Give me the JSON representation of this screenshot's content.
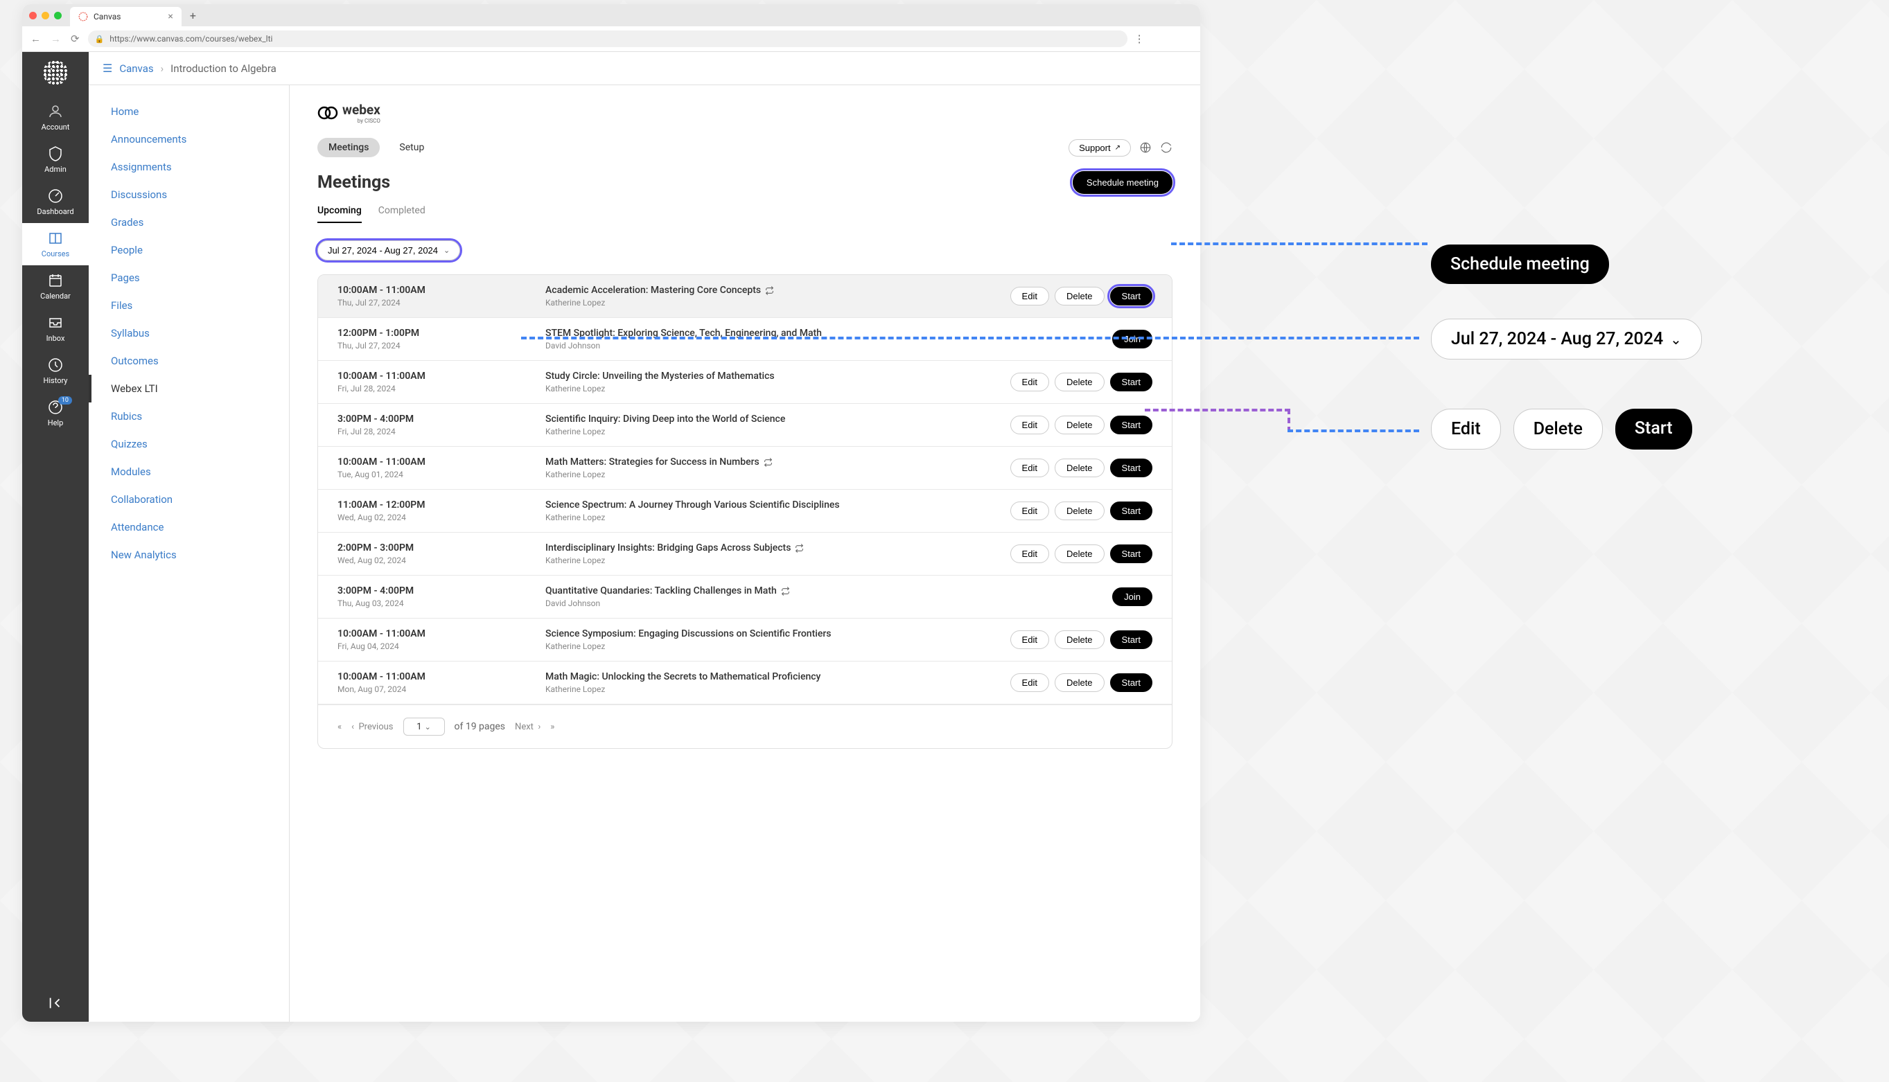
{
  "browser": {
    "tab_title": "Canvas",
    "url": "https://www.canvas.com/courses/webex_lti"
  },
  "global_nav": {
    "items": [
      {
        "label": "Account",
        "icon": "account"
      },
      {
        "label": "Admin",
        "icon": "admin"
      },
      {
        "label": "Dashboard",
        "icon": "dashboard"
      },
      {
        "label": "Courses",
        "icon": "courses",
        "active": true
      },
      {
        "label": "Calendar",
        "icon": "calendar"
      },
      {
        "label": "Inbox",
        "icon": "inbox"
      },
      {
        "label": "History",
        "icon": "history"
      },
      {
        "label": "Help",
        "icon": "help",
        "badge": "10"
      }
    ]
  },
  "breadcrumb": {
    "root": "Canvas",
    "current": "Introduction to Algebra"
  },
  "course_nav": {
    "items": [
      "Home",
      "Announcements",
      "Assignments",
      "Discussions",
      "Grades",
      "People",
      "Pages",
      "Files",
      "Syllabus",
      "Outcomes",
      "Webex LTI",
      "Rubics",
      "Quizzes",
      "Modules",
      "Collaboration",
      "Attendance",
      "New Analytics"
    ],
    "active": "Webex LTI"
  },
  "webex": {
    "logo": "webex",
    "logo_sub": "by CISCO",
    "main_tabs": {
      "meetings": "Meetings",
      "setup": "Setup"
    },
    "support": "Support",
    "title": "Meetings",
    "schedule_btn": "Schedule meeting",
    "subtabs": {
      "upcoming": "Upcoming",
      "completed": "Completed"
    },
    "date_range": "Jul 27, 2024 - Aug 27, 2024",
    "actions": {
      "edit": "Edit",
      "delete": "Delete",
      "start": "Start",
      "join": "Join"
    },
    "meetings": [
      {
        "time_range": "10:00AM - 11:00AM",
        "date": "Thu, Jul 27, 2024",
        "title": "Academic Acceleration: Mastering Core Concepts",
        "host": "Katherine Lopez",
        "recurring": true,
        "buttons": [
          "edit",
          "delete",
          "start"
        ],
        "highlighted": true,
        "start_focused": true
      },
      {
        "time_range": "12:00PM - 1:00PM",
        "date": "Thu, Jul 27, 2024",
        "title": "STEM Spotlight: Exploring Science, Tech, Engineering, and Math",
        "host": "David Johnson",
        "recurring": false,
        "buttons": [
          "join"
        ]
      },
      {
        "time_range": "10:00AM - 11:00AM",
        "date": "Fri, Jul 28, 2024",
        "title": "Study Circle: Unveiling the Mysteries of Mathematics",
        "host": "Katherine Lopez",
        "recurring": false,
        "buttons": [
          "edit",
          "delete",
          "start"
        ]
      },
      {
        "time_range": "3:00PM - 4:00PM",
        "date": "Fri, Jul 28, 2024",
        "title": "Scientific Inquiry: Diving Deep into the World of Science",
        "host": "Katherine Lopez",
        "recurring": false,
        "buttons": [
          "edit",
          "delete",
          "start"
        ]
      },
      {
        "time_range": "10:00AM - 11:00AM",
        "date": "Tue, Aug 01, 2024",
        "title": "Math Matters: Strategies for Success in Numbers",
        "host": "Katherine Lopez",
        "recurring": true,
        "buttons": [
          "edit",
          "delete",
          "start"
        ]
      },
      {
        "time_range": "11:00AM - 12:00PM",
        "date": "Wed, Aug 02, 2024",
        "title": "Science Spectrum: A Journey Through Various Scientific Disciplines",
        "host": "Katherine Lopez",
        "recurring": false,
        "buttons": [
          "edit",
          "delete",
          "start"
        ]
      },
      {
        "time_range": "2:00PM - 3:00PM",
        "date": "Wed, Aug 02, 2024",
        "title": "Interdisciplinary Insights: Bridging Gaps Across Subjects",
        "host": "Katherine Lopez",
        "recurring": true,
        "buttons": [
          "edit",
          "delete",
          "start"
        ]
      },
      {
        "time_range": "3:00PM - 4:00PM",
        "date": "Thu, Aug 03, 2024",
        "title": "Quantitative Quandaries: Tackling Challenges in Math",
        "host": "David Johnson",
        "recurring": true,
        "buttons": [
          "join"
        ]
      },
      {
        "time_range": "10:00AM - 11:00AM",
        "date": "Fri, Aug 04, 2024",
        "title": "Science Symposium: Engaging Discussions on Scientific Frontiers",
        "host": "Katherine Lopez",
        "recurring": false,
        "buttons": [
          "edit",
          "delete",
          "start"
        ]
      },
      {
        "time_range": "10:00AM - 11:00AM",
        "date": "Mon, Aug 07, 2024",
        "title": "Math Magic: Unlocking the Secrets to Mathematical Proficiency",
        "host": "Katherine Lopez",
        "recurring": false,
        "buttons": [
          "edit",
          "delete",
          "start"
        ]
      }
    ],
    "pagination": {
      "previous": "Previous",
      "next": "Next",
      "page": "1",
      "of_pages": "of 19 pages"
    }
  },
  "callouts": {
    "schedule": "Schedule meeting",
    "date_range": "Jul 27, 2024 - Aug 27, 2024",
    "edit": "Edit",
    "delete": "Delete",
    "start": "Start"
  }
}
